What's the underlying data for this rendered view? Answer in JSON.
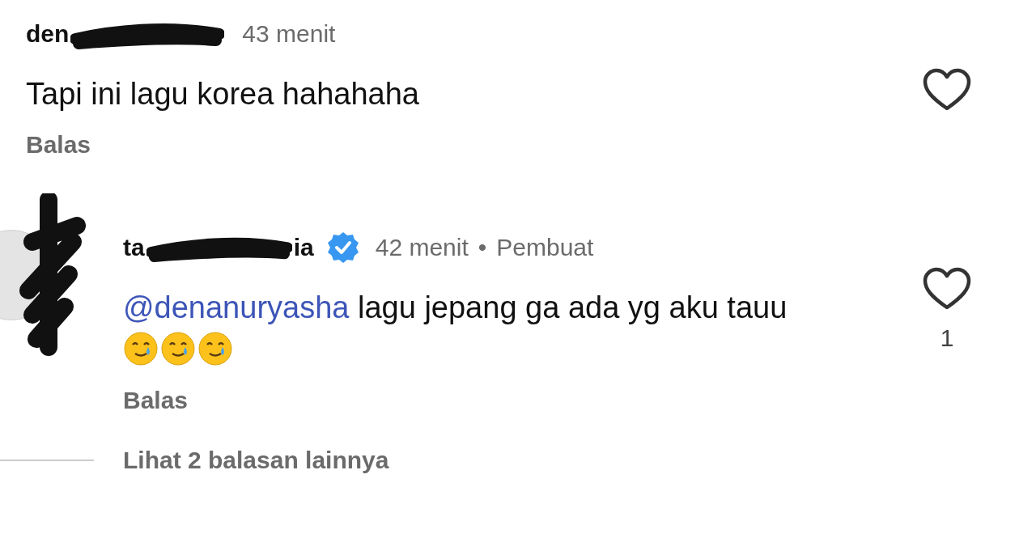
{
  "comments": [
    {
      "username_start": "den",
      "time": "43 menit",
      "text": "Tapi ini lagu korea hahahaha",
      "reply": "Balas",
      "liked": false
    },
    {
      "username_start": "ta",
      "username_end": "ia",
      "verified": true,
      "time": "42 menit",
      "separator": "•",
      "creator_label": "Pembuat",
      "text_mention": "@denanuryasha",
      "text": "lagu jepang ga ada yg aku tauu",
      "emojis": [
        {
          "kind": "smile-tear"
        },
        {
          "kind": "smile-tear"
        },
        {
          "kind": "smile-tear"
        }
      ],
      "reply": "Balas",
      "like_count": "1",
      "liked": false,
      "avatar": true
    }
  ],
  "more_replies": "Lihat 2 balasan lainnya"
}
